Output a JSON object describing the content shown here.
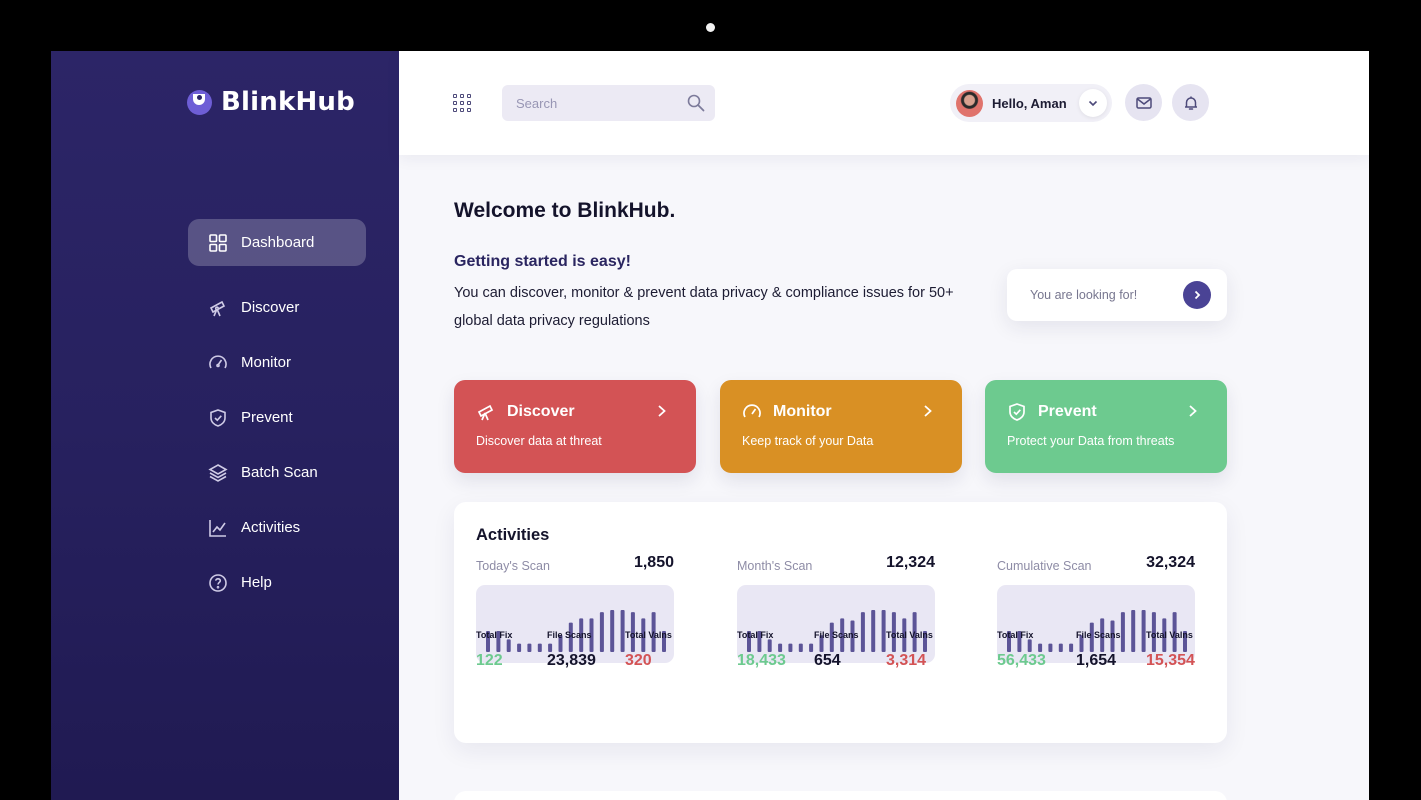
{
  "app": {
    "name": "BlinkHub"
  },
  "sidebar": {
    "items": [
      {
        "label": "Dashboard",
        "icon": "grid-icon",
        "active": true
      },
      {
        "label": "Discover",
        "icon": "telescope-icon"
      },
      {
        "label": "Monitor",
        "icon": "gauge-icon"
      },
      {
        "label": "Prevent",
        "icon": "shield-check-icon"
      },
      {
        "label": "Batch Scan",
        "icon": "layers-icon"
      },
      {
        "label": "Activities",
        "icon": "chart-line-icon"
      },
      {
        "label": "Help",
        "icon": "help-circle-icon"
      }
    ]
  },
  "topbar": {
    "search_placeholder": "Search",
    "greeting": "Hello, Aman"
  },
  "main": {
    "welcome": "Welcome to BlinkHub.",
    "subtitle": "Getting started is easy!",
    "description": "You can discover, monitor & prevent data privacy & compliance issues for 50+ global data privacy regulations",
    "looking_for": "You are looking for!",
    "cards": [
      {
        "title": "Discover",
        "subtitle": "Discover data at threat",
        "color": "#d35355"
      },
      {
        "title": "Monitor",
        "subtitle": "Keep track of your Data",
        "color": "#d99024"
      },
      {
        "title": "Prevent",
        "subtitle": "Protect your Data from threats",
        "color": "#6dca8f"
      }
    ]
  },
  "activities": {
    "title": "Activities",
    "stats": [
      {
        "label": "Today's Scan",
        "value": "1,850",
        "bars": [
          5,
          5,
          3,
          2,
          2,
          2,
          2,
          4,
          7,
          8,
          8,
          9.5,
          10,
          10,
          9.5,
          8,
          9.5,
          5
        ],
        "total_fix_label": "Total Fix",
        "total_fix": "122",
        "file_scans_label": "File Scans",
        "file_scans": "23,839",
        "total_vulns_label": "Total Valns",
        "total_vulns": "320"
      },
      {
        "label": "Month's Scan",
        "value": "12,324",
        "bars": [
          5,
          5,
          3,
          2,
          2,
          2,
          2,
          4,
          7,
          8,
          7.5,
          9.5,
          10,
          10,
          9.5,
          8,
          9.5,
          5
        ],
        "total_fix_label": "Total Fix",
        "total_fix": "18,433",
        "file_scans_label": "File Scans",
        "file_scans": "654",
        "total_vulns_label": "Total Valns",
        "total_vulns": "3,314"
      },
      {
        "label": "Cumulative Scan",
        "value": "32,324",
        "bars": [
          5,
          5,
          3,
          2,
          2,
          2,
          2,
          4,
          7,
          8,
          7.5,
          9.5,
          10,
          10,
          9.5,
          8,
          9.5,
          5
        ],
        "total_fix_label": "Total Fix",
        "total_fix": "56,433",
        "file_scans_label": "File Scans",
        "file_scans": "1,654",
        "total_vulns_label": "Total Valns",
        "total_vulns": "15,354"
      }
    ]
  },
  "colors": {
    "sidebar": "#2c2567",
    "accent": "#4a4395",
    "bars": "#5c5497",
    "fix": "#6dca8f",
    "vulns": "#d35355"
  }
}
